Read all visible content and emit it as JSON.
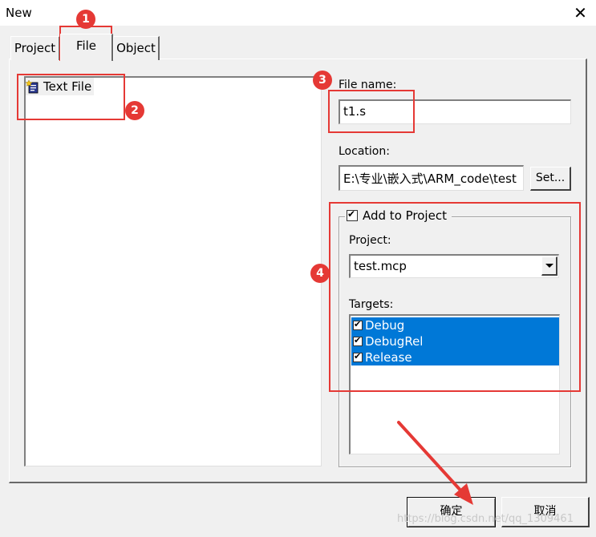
{
  "window": {
    "title": "New",
    "close_glyph": "✕"
  },
  "tabs": [
    {
      "label": "Project",
      "active": false
    },
    {
      "label": "File",
      "active": true
    },
    {
      "label": "Object",
      "active": false
    }
  ],
  "file_types": [
    {
      "label": "Text File",
      "icon": "text-file-icon"
    }
  ],
  "file_name": {
    "label": "File name:",
    "value": "t1.s"
  },
  "location": {
    "label": "Location:",
    "value": "E:\\专业\\嵌入式\\ARM_code\\test",
    "set_button": "Set..."
  },
  "add_to_project": {
    "label": "Add to Project",
    "checked": true
  },
  "project": {
    "label": "Project:",
    "value": "test.mcp"
  },
  "targets": {
    "label": "Targets:",
    "items": [
      {
        "label": "Debug",
        "checked": true
      },
      {
        "label": "DebugRel",
        "checked": true
      },
      {
        "label": "Release",
        "checked": true
      }
    ]
  },
  "buttons": {
    "ok": "确定",
    "cancel": "取消"
  },
  "annotations": [
    "1",
    "2",
    "3",
    "4"
  ],
  "watermark": "https://blog.csdn.net/qq_1309461",
  "colors": {
    "annotation": "#e53935",
    "selection": "#0078d7"
  }
}
